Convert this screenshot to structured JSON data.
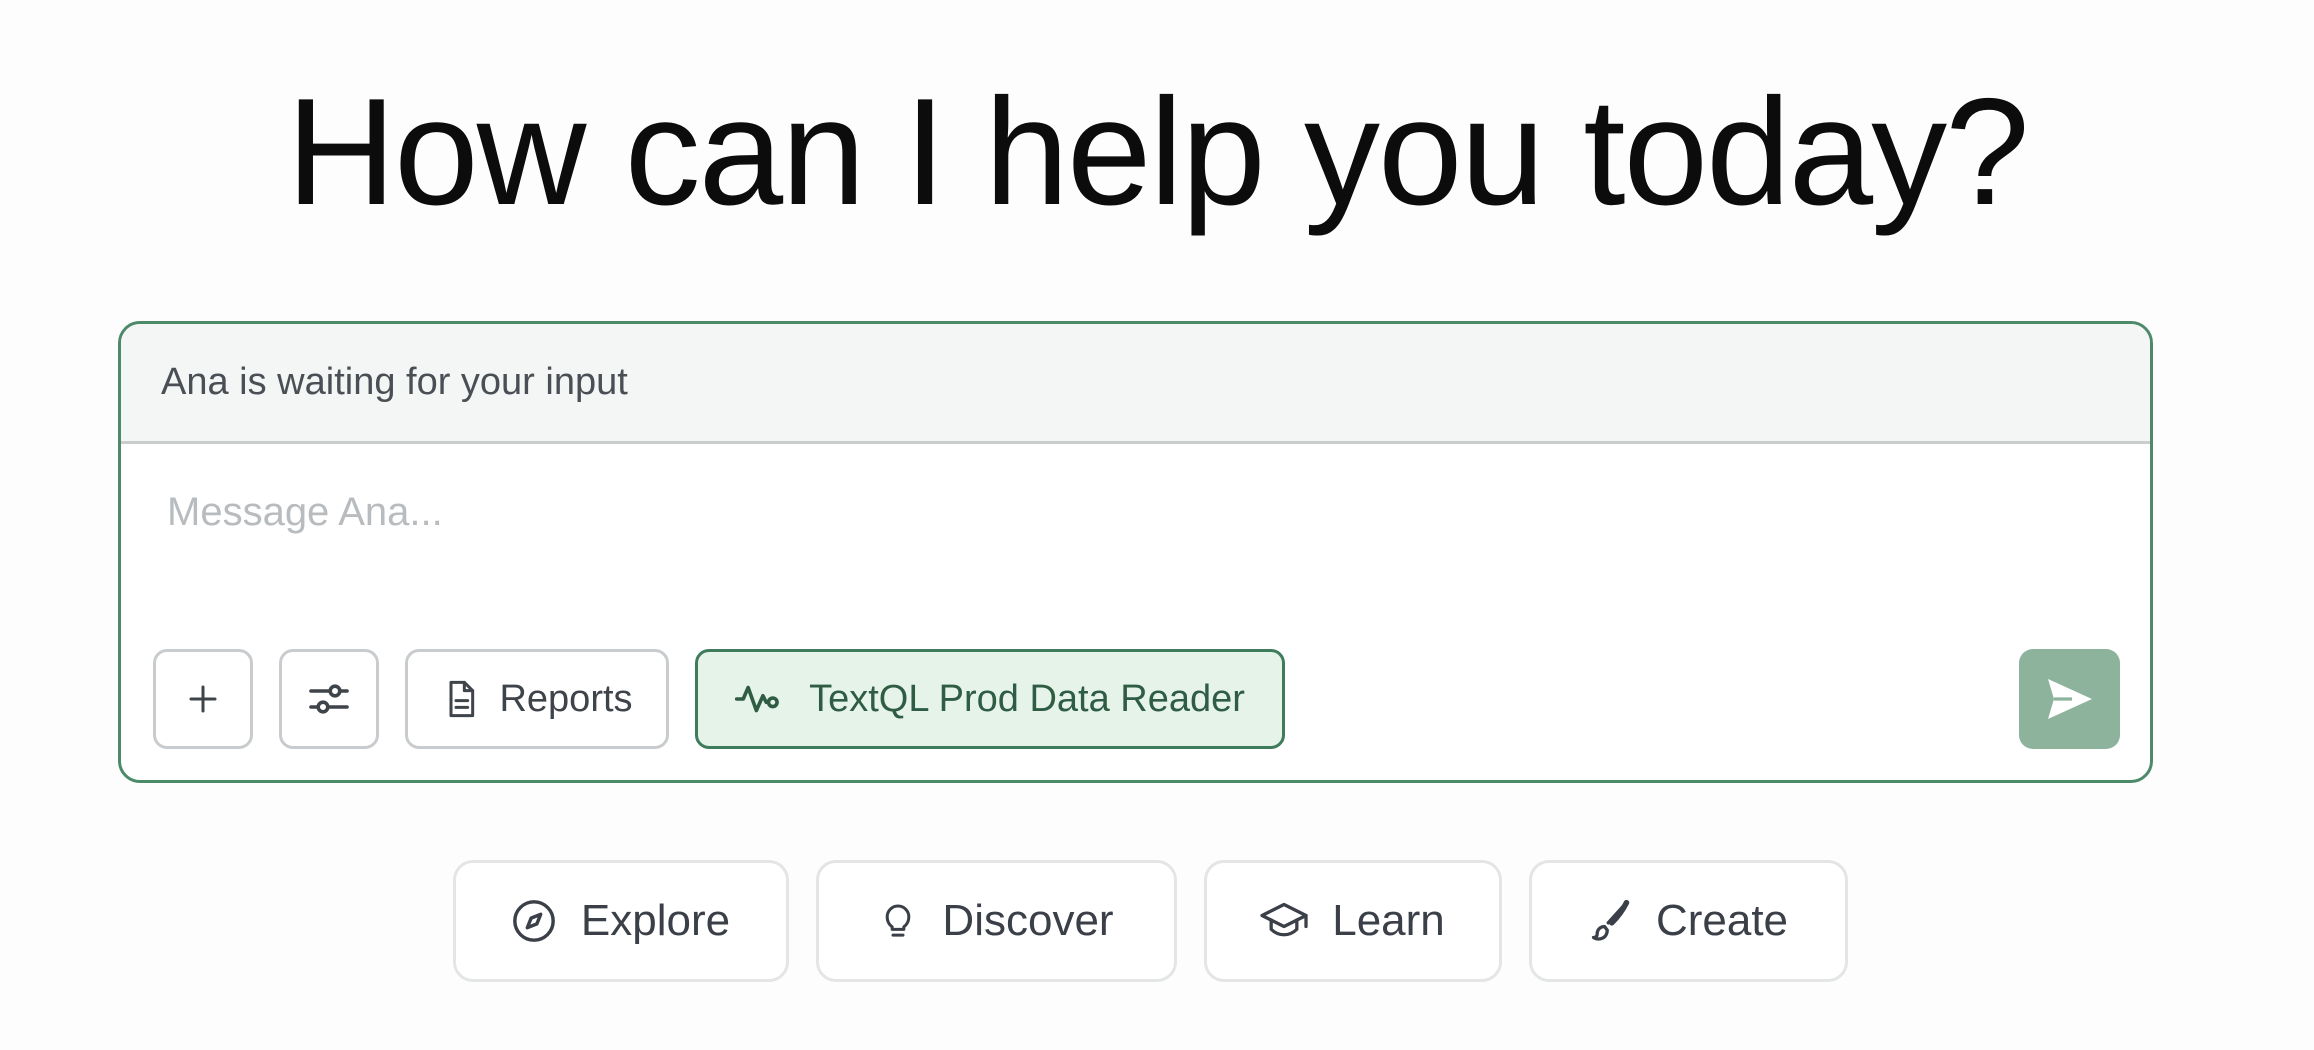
{
  "heading": "How can I help you today?",
  "composer": {
    "status_text": "Ana is waiting for your input",
    "input_placeholder": "Message Ana...",
    "input_value": "",
    "toolbar": {
      "add_icon": "plus-icon",
      "settings_icon": "sliders-icon",
      "reports_label": "Reports",
      "reports_icon": "document-icon",
      "connector_label": "TextQL Prod Data Reader",
      "connector_icon": "activity-icon"
    },
    "send_icon": "send-icon"
  },
  "suggestions": [
    {
      "label": "Explore",
      "icon": "compass-icon"
    },
    {
      "label": "Discover",
      "icon": "lightbulb-icon"
    },
    {
      "label": "Learn",
      "icon": "graduation-cap-icon"
    },
    {
      "label": "Create",
      "icon": "paintbrush-icon"
    }
  ],
  "colors": {
    "accent_border": "#4d8a6a",
    "connector_bg": "#e6f3e9",
    "send_bg": "#8db39d"
  }
}
